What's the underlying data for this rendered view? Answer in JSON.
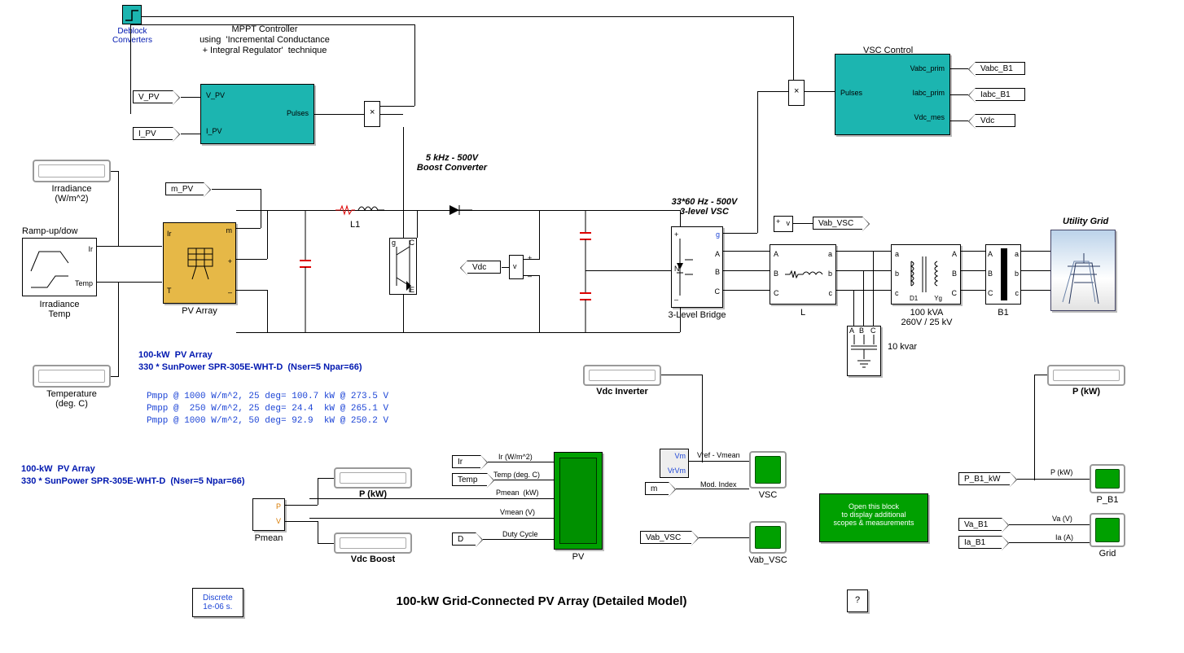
{
  "title": "100-kW Grid-Connected PV Array (Detailed Model)",
  "discrete": {
    "line1": "Discrete",
    "line2": "1e-06 s."
  },
  "help": "?",
  "deblock": {
    "label": "Deblock\nConverters"
  },
  "mppt": {
    "title": "MPPT Controller\nusing  'Incremental Conductance\n+ Integral Regulator'  technique",
    "in1": "V_PV",
    "in2": "I_PV",
    "out": "Pulses"
  },
  "tags": {
    "vpv": "V_PV",
    "ipv": "I_PV",
    "mpv": "m_PV",
    "vdc": "Vdc",
    "vab_vsc": "Vab_VSC",
    "vabc_b1": "Vabc_B1",
    "iabc_b1": "Iabc_B1",
    "vdc2": "Vdc",
    "p_b1_kw": "P_B1_kW",
    "va_b1": "Va_B1",
    "ia_b1": "Ia_B1",
    "d_tag": "D",
    "m_tag": "m",
    "vab_vsc2": "Vab_VSC"
  },
  "irradiance_display": "Irradiance\n(W/m^2)",
  "temperature_display": "Temperature\n(deg. C)",
  "source": {
    "name": "Ramp-up/dow",
    "port1": "Ir",
    "port2": "Temp",
    "block_label": "Irradiance\nTemp"
  },
  "pv_array": {
    "name": "PV Array",
    "port_ir": "Ir",
    "port_t": "T",
    "port_m": "m",
    "plus": "+",
    "minus": "–"
  },
  "boost_label": "5 kHz - 500V\nBoost Converter",
  "l1": "L1",
  "vsc_hdr": "33*60 Hz - 500V\n3-level VSC",
  "vsc_block": {
    "name": "3-Level Bridge",
    "g": "g",
    "A": "A",
    "B": "B",
    "C": "C"
  },
  "vsc_control": {
    "name": "VSC Control",
    "out": "Pulses",
    "in1": "Vabc_prim",
    "in2": "Iabc_prim",
    "in3": "Vdc_mes"
  },
  "L_block": {
    "name": "L",
    "A": "A",
    "B": "B",
    "C": "C",
    "a": "a",
    "b": "b",
    "c": "c"
  },
  "cap_block": {
    "label": "10 kvar",
    "A": "A",
    "B": "B",
    "C": "C"
  },
  "xfmr": {
    "name": "100 kVA\n260V / 25 kV",
    "a": "a",
    "b": "b",
    "c": "c",
    "A": "A",
    "B": "B",
    "C": "C",
    "D1": "D1",
    "Yg": "Yg"
  },
  "b1": {
    "name": "B1",
    "A": "A",
    "B": "B",
    "C": "C",
    "a": "a",
    "b": "b",
    "c": "c"
  },
  "grid": {
    "name": "Utility Grid"
  },
  "pv_info": {
    "h1": "100-kW  PV Array",
    "h2": "330 * SunPower SPR-305E-WHT-D  (Nser=5 Npar=66)",
    "l1": "Pmpp @ 1000 W/m^2, 25 deg= 100.7 kW @ 273.5 V",
    "l2": "Pmpp @  250 W/m^2, 25 deg= 24.4  kW @ 265.1 V",
    "l3": "Pmpp @ 1000 W/m^2, 50 deg= 92.9  kW @ 250.2 V"
  },
  "pv_info2": {
    "h1": "100-kW  PV Array",
    "h2": "330 * SunPower SPR-305E-WHT-D  (Nser=5 Npar=66)"
  },
  "pmean": {
    "name": "Pmean",
    "P": "P",
    "V": "V"
  },
  "disp_pkw": "P (kW)",
  "disp_vdcboost": "Vdc Boost",
  "disp_vdcinv": "Vdc Inverter",
  "disp_pkw2": "P (kW)",
  "pv_scope": {
    "name": "PV",
    "in1": "Ir (W/m^2)",
    "in2": "Temp (deg. C)",
    "in3": "Pmean  (kW)",
    "in4": "Vmean (V)",
    "in5": "Duty Cycle",
    "tag_ir": "Ir",
    "tag_temp": "Temp"
  },
  "vsc_scope": {
    "name": "VSC",
    "in1": "Vref - Vmean",
    "in2": "Mod. Index",
    "vm": "Vm",
    "vrvm": "VrVm"
  },
  "vab_scope": {
    "name": "Vab_VSC"
  },
  "open_block": "Open this block\nto display additional\nscopes & measurements",
  "pb1_scope": {
    "name": "P_B1",
    "sig": "P (kW)"
  },
  "grid_scope": {
    "name": "Grid",
    "va": "Va (V)",
    "ia": "Ia (A)"
  },
  "vmeter": {
    "plus": "+",
    "minus": "–",
    "v": "v"
  }
}
